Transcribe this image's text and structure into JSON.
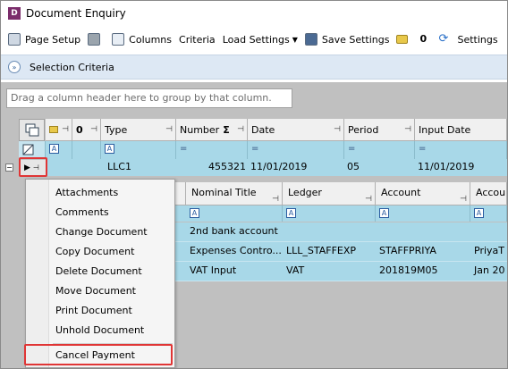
{
  "window": {
    "title": "Document Enquiry",
    "app_icon_letter": "D"
  },
  "toolbar": {
    "page_setup": "Page Setup",
    "columns": "Columns",
    "criteria": "Criteria",
    "load_settings": "Load Settings",
    "save_settings": "Save Settings",
    "paperclip_glyph": "0",
    "settings": "Settings"
  },
  "selection_criteria": {
    "label": "Selection Criteria"
  },
  "group_box": {
    "placeholder": "Drag a column header here to group by that column."
  },
  "grid": {
    "columns": [
      {
        "key": "type",
        "label": "Type"
      },
      {
        "key": "number",
        "label": "Number"
      },
      {
        "key": "date",
        "label": "Date"
      },
      {
        "key": "period",
        "label": "Period"
      },
      {
        "key": "input_date",
        "label": "Input Date"
      }
    ],
    "filter_glyph": "=",
    "row": {
      "type": "LLC1",
      "number": "455321",
      "date": "11/01/2019",
      "period": "05",
      "input_date": "11/01/2019"
    }
  },
  "subgrid": {
    "columns": [
      {
        "key": "nominal_title",
        "label": "Nominal Title"
      },
      {
        "key": "ledger",
        "label": "Ledger"
      },
      {
        "key": "account",
        "label": "Account"
      },
      {
        "key": "account2",
        "label": "Accou"
      }
    ],
    "rows": [
      {
        "nominal_title": "2nd bank account",
        "ledger": "",
        "account": "",
        "account2": ""
      },
      {
        "nominal_title": "Expenses Contro...",
        "ledger": "LLL_STAFFEXP",
        "account": "STAFFPRIYA",
        "account2": "PriyaT"
      },
      {
        "nominal_title": "VAT Input",
        "ledger": "VAT",
        "account": "201819M05",
        "account2": "Jan 20"
      }
    ]
  },
  "context_menu": {
    "items": [
      "Attachments",
      "Comments",
      "Change Document",
      "Copy Document",
      "Delete Document",
      "Move Document",
      "Print Document",
      "Unhold Document",
      "Cancel Payment"
    ]
  },
  "colors": {
    "selection_bar": "#dde8f4",
    "row_highlight": "#a8d8e8",
    "grid_background": "#c0c0c0",
    "callout": "#e03535",
    "app_icon": "#7b2d6b"
  }
}
